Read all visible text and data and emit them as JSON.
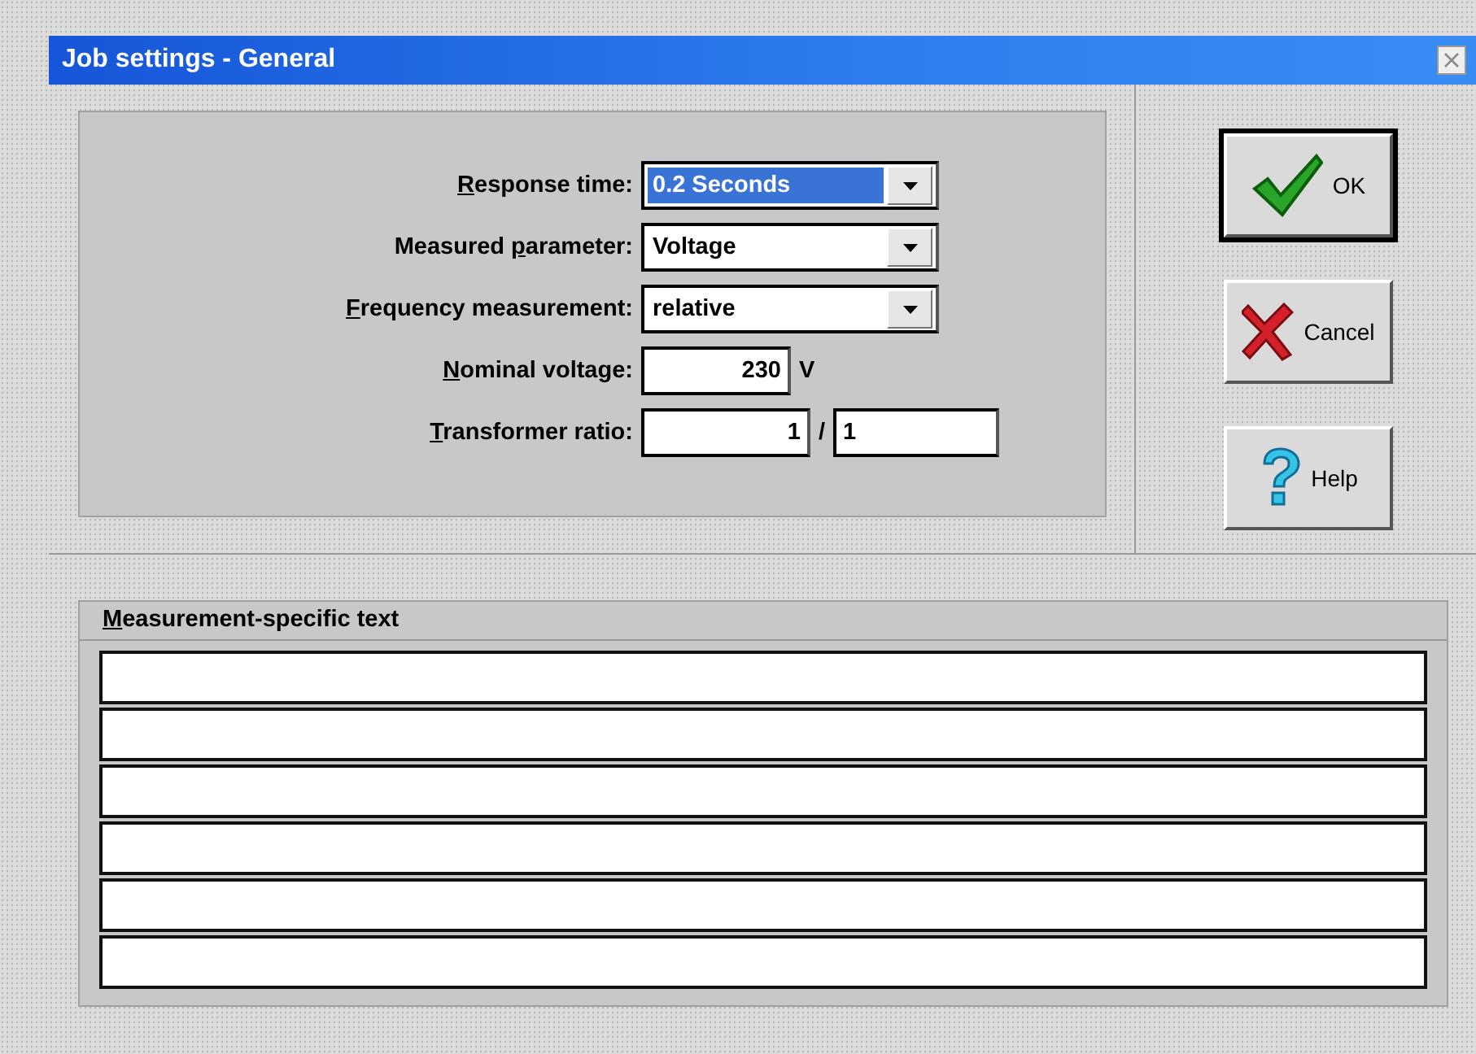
{
  "window": {
    "title": "Job settings - General"
  },
  "fields": [
    {
      "kind": "dropdown",
      "label": {
        "key": "R",
        "after": "esponse time:"
      },
      "value": "0.2 Seconds",
      "focused": true
    },
    {
      "kind": "dropdown",
      "label": {
        "before": "Measured ",
        "key": "p",
        "after": "arameter:"
      },
      "value": "Voltage",
      "focused": false
    },
    {
      "kind": "dropdown",
      "label": {
        "key": "F",
        "after": "requency measurement:"
      },
      "value": "relative",
      "focused": false
    },
    {
      "kind": "number",
      "label": {
        "key": "N",
        "after": "ominal voltage:"
      },
      "value": "230",
      "unit": "V",
      "focused": false
    },
    {
      "kind": "ratio",
      "label": {
        "key": "T",
        "after": "ransformer ratio:"
      },
      "value": "1",
      "separator": "/",
      "value2": "1",
      "focused": false
    }
  ],
  "buttons": [
    {
      "kind": "ok",
      "label": "OK",
      "default": true
    },
    {
      "kind": "cancel",
      "label": "Cancel",
      "default": false
    },
    {
      "kind": "help",
      "label": "Help",
      "default": false
    }
  ],
  "text_section": {
    "title": {
      "key": "M",
      "after": "easurement-specific text"
    },
    "lines": [
      {
        "kind": "text-line"
      },
      {
        "kind": "text-line"
      },
      {
        "kind": "text-line"
      },
      {
        "kind": "text-line"
      },
      {
        "kind": "text-line"
      },
      {
        "kind": "text-line"
      }
    ]
  }
}
